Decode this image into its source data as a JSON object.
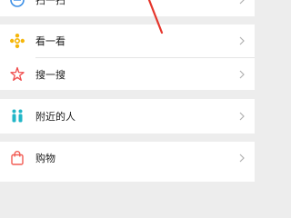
{
  "menu": {
    "top_item": {
      "label": "扫一扫",
      "icon": "scan-icon"
    },
    "items": [
      {
        "label": "看一看",
        "icon": "look-icon",
        "color": "#f5b60a"
      },
      {
        "label": "搜一搜",
        "icon": "search-star-icon",
        "color": "#f04c4c"
      },
      {
        "label": "附近的人",
        "icon": "nearby-people-icon",
        "color": "#21b6c7"
      },
      {
        "label": "购物",
        "icon": "shopping-bag-icon",
        "color": "#f25c54"
      }
    ],
    "chevron_icon": "chevron-right-icon"
  },
  "colors": {
    "background": "#ededed",
    "card": "#ffffff",
    "annotation_arrow": "#e5352b"
  }
}
